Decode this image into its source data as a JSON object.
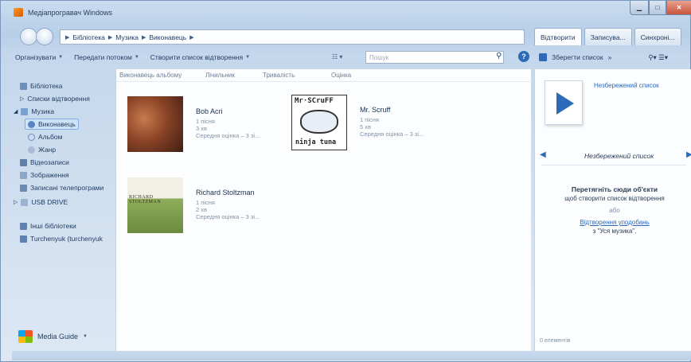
{
  "window": {
    "title": "Медіапрогравач Windows"
  },
  "nav": {
    "breadcrumb": [
      "Бібліотека",
      "Музика",
      "Виконавець"
    ]
  },
  "right_tabs": [
    "Відтворити",
    "Записува...",
    "Синхроні..."
  ],
  "toolbar": {
    "organize": "Організувати",
    "stream": "Передати потоком",
    "create_playlist": "Створити список відтворення",
    "search_placeholder": "Пошук"
  },
  "right_toolbar": {
    "save_list": "Зберегти список"
  },
  "sidebar": {
    "items": [
      {
        "label": "Бібліотека"
      },
      {
        "label": "Списки відтворення"
      },
      {
        "label": "Музика"
      },
      {
        "label": "Виконавець"
      },
      {
        "label": "Альбом"
      },
      {
        "label": "Жанр"
      },
      {
        "label": "Відеозаписи"
      },
      {
        "label": "Зображення"
      },
      {
        "label": "Записані телепрограми"
      },
      {
        "label": "USB DRIVE"
      },
      {
        "label": "Інші бібліотеки"
      },
      {
        "label": "Turchenyuk (turchenyuk"
      }
    ],
    "media_guide": "Media Guide"
  },
  "columns": [
    "Виконавець альбому",
    "Лічильник",
    "Тривалість",
    "Оцінка"
  ],
  "artists": [
    {
      "name": "Bob Acri",
      "songs": "1 пісня",
      "duration": "3 хв",
      "rating": "Середня оцінка – 3 зі..."
    },
    {
      "name": "Mr. Scruff",
      "songs": "1 пісня",
      "duration": "5 хв",
      "rating": "Середня оцінка – 3 зі..."
    },
    {
      "name": "Richard Stoltzman",
      "songs": "1 пісня",
      "duration": "2 хв",
      "rating": "Середня оцінка – 3 зі..."
    }
  ],
  "covers": {
    "scruff_text_top": "Mr·SCruFF",
    "scruff_text_bottom": "ninja tuna",
    "stoltzman_text": "RICHARD STOLTZMAN"
  },
  "right_panel": {
    "unsaved_list_title": "Незбережений список",
    "playlist_name": "Незбережений список",
    "drop_bold": "Перетягніть сюди об'єкти",
    "drop_sub": "щоб створити список відтворення",
    "or": "або",
    "link": "Відтворення уподобань",
    "link_sub": "з \"Уся музика\".",
    "item_count": "0 елементів"
  },
  "colors": {
    "accent": "#2d6ab8",
    "chrome": "#c9dcf0",
    "panel": "#fbfdff"
  }
}
